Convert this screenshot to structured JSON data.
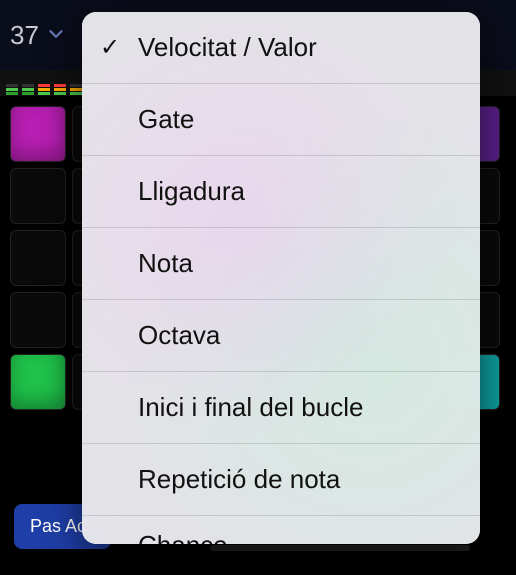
{
  "topbar": {
    "value": "37",
    "chevron_icon": "chevron-down"
  },
  "bottom_button": {
    "label": "Pas Acti"
  },
  "menu": {
    "items": [
      {
        "label": "Velocitat / Valor",
        "checked": true
      },
      {
        "label": "Gate",
        "checked": false
      },
      {
        "label": "Lligadura",
        "checked": false
      },
      {
        "label": "Nota",
        "checked": false
      },
      {
        "label": "Octava",
        "checked": false
      },
      {
        "label": "Inici i final del bucle",
        "checked": false
      },
      {
        "label": "Repetició de nota",
        "checked": false
      },
      {
        "label": "Chance",
        "checked": false
      }
    ],
    "checkmark": "✓"
  }
}
